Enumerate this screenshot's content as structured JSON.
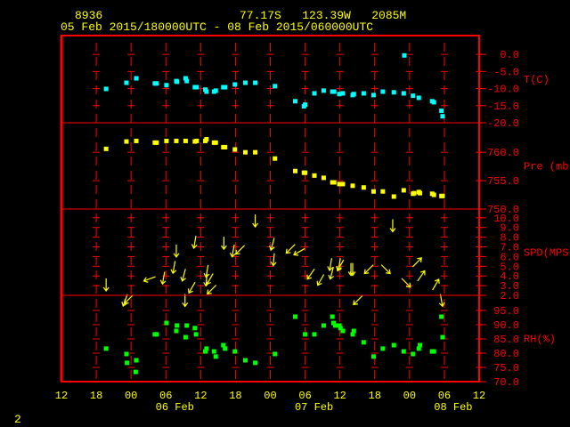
{
  "header": {
    "station_id": "8936",
    "location": "77.17S   123.39W   2085M",
    "time_range": "05 Feb 2015/180000UTC - 08 Feb 2015/060000UTC"
  },
  "page_number": "2",
  "colors": {
    "frame": "#ff0000",
    "text": "#ffff00",
    "temp": "#00ffff",
    "pressure": "#ffff00",
    "wind": "#ffff00",
    "rh": "#00ff00"
  },
  "chart_data": {
    "type": "scatter",
    "title": "8936 77.17S 123.39W 2085M",
    "subtitle": "05 Feb 2015/180000UTC - 08 Feb 2015/060000UTC",
    "x_unit": "hours since 05 Feb 2015 12UTC",
    "xlim": [
      0,
      72
    ],
    "x_tick_labels": [
      "12",
      "18",
      "00",
      "06",
      "12",
      "18",
      "00",
      "06",
      "12",
      "18",
      "00",
      "06",
      "12"
    ],
    "date_labels": [
      {
        "hour": 18,
        "label": "06 Feb"
      },
      {
        "hour": 42,
        "label": "07 Feb"
      },
      {
        "hour": 66,
        "label": "08 Feb"
      }
    ],
    "panels": [
      {
        "name": "temperature",
        "label": "T(C)",
        "ylim": [
          5.5,
          -20
        ],
        "ticks": [
          0,
          -5,
          -10,
          -15,
          -20
        ],
        "tick_labels": [
          "0.0",
          "-5.0",
          "-10.0",
          "-15.0",
          "-20.0"
        ],
        "marker": "square",
        "color": "#00ffff",
        "x": [
          7.7,
          11.2,
          12.9,
          16.1,
          16.4,
          18.1,
          19.8,
          19.9,
          21.4,
          21.6,
          23.0,
          23.3,
          24.8,
          25.0,
          26.3,
          26.6,
          27.9,
          28.2,
          29.9,
          31.7,
          33.4,
          36.8,
          40.3,
          41.8,
          42.0,
          43.6,
          45.2,
          46.7,
          47.0,
          47.9,
          48.5,
          50.2,
          50.4,
          52.1,
          53.8,
          55.4,
          57.3,
          59.0,
          59.1,
          60.6,
          61.6,
          63.9,
          64.2,
          65.5,
          65.7
        ],
        "y": [
          -10.1,
          -8.3,
          -7.0,
          -8.5,
          -8.5,
          -9.0,
          -7.8,
          -8.0,
          -7.0,
          -7.8,
          -9.6,
          -9.6,
          -10.3,
          -10.9,
          -10.9,
          -10.6,
          -9.6,
          -9.6,
          -8.8,
          -8.3,
          -8.3,
          -9.3,
          -13.7,
          -15.2,
          -14.7,
          -11.4,
          -10.6,
          -10.9,
          -10.9,
          -11.6,
          -11.4,
          -11.9,
          -11.6,
          -11.4,
          -11.9,
          -10.9,
          -11.1,
          -11.4,
          -0.3,
          -12.1,
          -12.7,
          -13.7,
          -14.0,
          -16.5,
          -18.1
        ]
      },
      {
        "name": "pressure",
        "label": "Pre (mb)",
        "ylim": [
          765.2,
          750
        ],
        "ticks": [
          760,
          755,
          750
        ],
        "tick_labels": [
          "760.0",
          "755.0",
          "750.0"
        ],
        "marker": "square",
        "color": "#ffff00",
        "x": [
          7.7,
          11.2,
          12.9,
          16.1,
          16.4,
          18.1,
          19.8,
          21.4,
          23.0,
          23.3,
          24.8,
          25.0,
          26.3,
          26.6,
          27.9,
          28.2,
          29.9,
          31.7,
          33.4,
          36.8,
          40.3,
          41.8,
          42.0,
          43.6,
          45.2,
          46.7,
          47.0,
          47.9,
          48.5,
          50.2,
          52.1,
          53.8,
          55.4,
          57.3,
          59.0,
          60.6,
          60.8,
          61.6,
          61.8,
          63.9,
          64.2,
          65.5,
          65.7
        ],
        "y": [
          760.6,
          761.9,
          762.0,
          761.7,
          761.7,
          762.0,
          762.0,
          762.0,
          761.9,
          762.0,
          762.0,
          762.3,
          761.7,
          761.7,
          760.9,
          760.9,
          760.5,
          760.0,
          760.0,
          758.9,
          756.7,
          756.4,
          756.4,
          755.9,
          755.5,
          754.7,
          754.7,
          754.4,
          754.4,
          754.1,
          753.8,
          753.1,
          753.1,
          752.2,
          753.3,
          752.7,
          752.8,
          753.0,
          752.8,
          752.7,
          752.5,
          752.3,
          752.3
        ]
      },
      {
        "name": "wind",
        "label": "SPD(MPS)",
        "ylim": [
          10.9,
          2
        ],
        "ticks": [
          10,
          9,
          8,
          7,
          6,
          5,
          4,
          3,
          2
        ],
        "tick_labels": [
          "10.0",
          "9.0",
          "8.0",
          "7.0",
          "6.0",
          "5.0",
          "4.0",
          "3.0",
          "2.0"
        ],
        "marker": "arrow",
        "color": "#ffff00",
        "x": [
          7.7,
          11.0,
          11.6,
          15.2,
          17.6,
          19.8,
          19.4,
          21.1,
          22.5,
          23.0,
          25.1,
          25.6,
          25.9,
          28.0,
          21.3,
          25.0,
          33.4,
          29.6,
          30.8,
          36.4,
          36.6,
          39.5,
          41.0,
          43.0,
          44.7,
          46.4,
          46.6,
          47.9,
          48.1,
          50.2,
          57.1,
          53.0,
          55.9,
          51.1,
          59.4,
          61.3,
          62.0,
          64.5,
          65.5,
          49.9
        ],
        "y": [
          3.1,
          1.5,
          1.6,
          3.7,
          3.8,
          6.6,
          4.9,
          4.1,
          2.8,
          7.5,
          4.5,
          3.7,
          2.6,
          7.4,
          1.5,
          3.6,
          9.7,
          6.6,
          6.7,
          7.3,
          5.7,
          6.8,
          6.5,
          4.2,
          3.6,
          5.2,
          4.3,
          5.2,
          5.1,
          4.7,
          9.2,
          4.7,
          4.7,
          1.5,
          3.3,
          5.4,
          4.0,
          3.1,
          1.5,
          4.7
        ],
        "direction_to_deg": [
          180,
          200,
          225,
          250,
          190,
          180,
          190,
          195,
          210,
          190,
          190,
          210,
          225,
          180,
          180,
          185,
          180,
          190,
          225,
          195,
          185,
          225,
          240,
          215,
          210,
          190,
          195,
          190,
          210,
          180,
          180,
          225,
          135,
          225,
          135,
          45,
          35,
          30,
          170,
          180
        ]
      },
      {
        "name": "relative_humidity",
        "label": "RH(%)",
        "ylim": [
          100.3,
          70
        ],
        "ticks": [
          95,
          90,
          85,
          80,
          75,
          70
        ],
        "tick_labels": [
          "95.0",
          "90.0",
          "85.0",
          "80.0",
          "75.0",
          "70.0"
        ],
        "marker": "square",
        "color": "#00ff00",
        "x": [
          7.7,
          11.2,
          11.3,
          12.9,
          12.8,
          16.1,
          16.4,
          18.1,
          19.8,
          19.9,
          21.4,
          21.6,
          23.0,
          23.2,
          24.8,
          25.0,
          26.3,
          26.6,
          27.9,
          28.2,
          29.9,
          31.7,
          33.4,
          36.8,
          40.3,
          42.0,
          43.6,
          45.2,
          46.7,
          46.9,
          47.2,
          47.9,
          48.1,
          48.5,
          50.4,
          50.2,
          52.1,
          53.8,
          55.4,
          57.3,
          59.0,
          60.6,
          61.6,
          61.8,
          63.9,
          64.2,
          65.5,
          65.7
        ],
        "y": [
          81.6,
          79.7,
          76.6,
          77.5,
          73.4,
          86.6,
          86.6,
          90.6,
          87.8,
          89.7,
          85.6,
          89.7,
          88.8,
          86.6,
          80.6,
          81.6,
          80.6,
          78.8,
          82.8,
          81.6,
          80.6,
          77.5,
          76.6,
          79.7,
          92.8,
          86.6,
          86.6,
          89.7,
          92.8,
          90.6,
          89.7,
          89.7,
          88.8,
          87.8,
          87.8,
          86.6,
          83.8,
          78.8,
          81.6,
          82.8,
          80.6,
          79.7,
          81.6,
          82.8,
          80.6,
          80.6,
          92.8,
          85.6
        ]
      }
    ]
  }
}
